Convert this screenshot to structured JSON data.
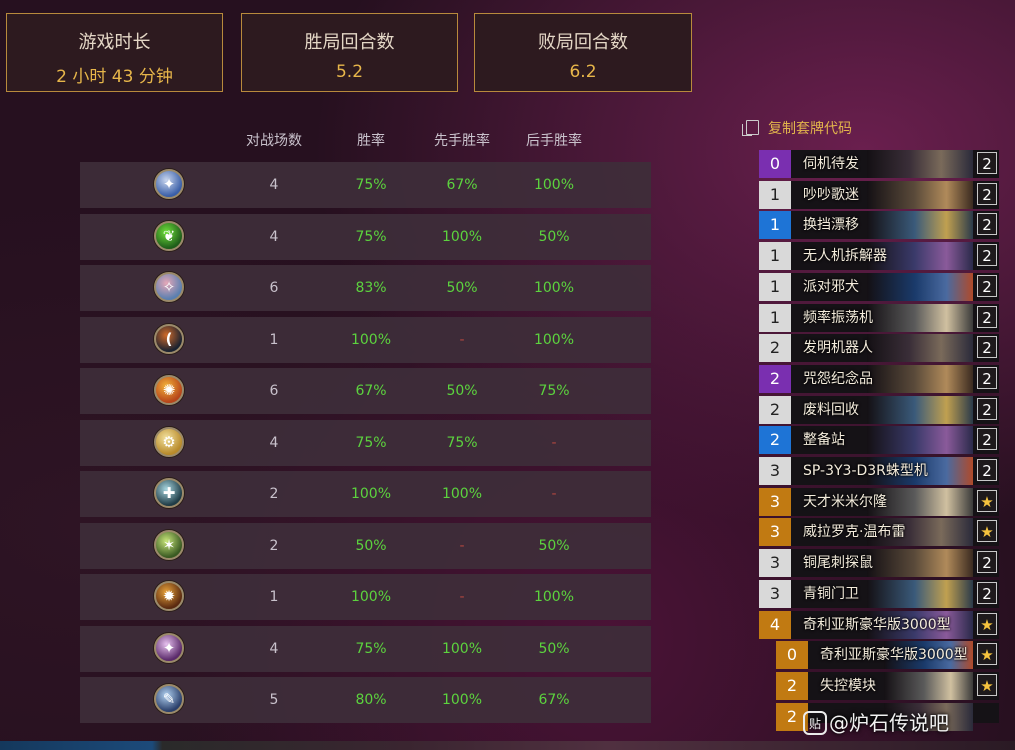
{
  "summary": {
    "cards": [
      {
        "title": "游戏时长",
        "value": "2 小时 43 分钟"
      },
      {
        "title": "胜局回合数",
        "value": "5.2"
      },
      {
        "title": "败局回合数",
        "value": "6.2"
      }
    ]
  },
  "stats_table": {
    "headers": [
      "对战场数",
      "胜率",
      "先手胜率",
      "后手胜率"
    ],
    "rows": [
      {
        "icon": "mage-hero-icon",
        "games": "4",
        "winrate": "75%",
        "first": "67%",
        "second": "100%"
      },
      {
        "icon": "druid-hero-icon",
        "games": "4",
        "winrate": "75%",
        "first": "100%",
        "second": "50%"
      },
      {
        "icon": "shaman-hero-icon",
        "games": "6",
        "winrate": "83%",
        "first": "50%",
        "second": "100%"
      },
      {
        "icon": "hunter-hero-icon",
        "games": "1",
        "winrate": "100%",
        "first": "-",
        "second": "100%"
      },
      {
        "icon": "warlock-hero-icon",
        "games": "6",
        "winrate": "67%",
        "first": "50%",
        "second": "75%"
      },
      {
        "icon": "paladin-hero-icon",
        "games": "4",
        "winrate": "75%",
        "first": "75%",
        "second": "-"
      },
      {
        "icon": "warrior-hero-icon",
        "games": "2",
        "winrate": "100%",
        "first": "100%",
        "second": "-"
      },
      {
        "icon": "rogue-hero-icon",
        "games": "2",
        "winrate": "50%",
        "first": "-",
        "second": "50%"
      },
      {
        "icon": "demon-hunter-hero-icon",
        "games": "1",
        "winrate": "100%",
        "first": "-",
        "second": "100%"
      },
      {
        "icon": "priest-hero-icon",
        "games": "4",
        "winrate": "75%",
        "first": "100%",
        "second": "50%"
      },
      {
        "icon": "death-knight-hero-icon",
        "games": "5",
        "winrate": "80%",
        "first": "100%",
        "second": "67%"
      }
    ]
  },
  "deck": {
    "copy_label": "复制套牌代码",
    "cards": [
      {
        "cost": "0",
        "name": "伺机待发",
        "count": "2",
        "rarity": "epic"
      },
      {
        "cost": "1",
        "name": "吵吵歌迷",
        "count": "2",
        "rarity": "common"
      },
      {
        "cost": "1",
        "name": "换挡漂移",
        "count": "2",
        "rarity": "rare"
      },
      {
        "cost": "1",
        "name": "无人机拆解器",
        "count": "2",
        "rarity": "common"
      },
      {
        "cost": "1",
        "name": "派对邪犬",
        "count": "2",
        "rarity": "common"
      },
      {
        "cost": "1",
        "name": "频率振荡机",
        "count": "2",
        "rarity": "common"
      },
      {
        "cost": "2",
        "name": "发明机器人",
        "count": "2",
        "rarity": "common"
      },
      {
        "cost": "2",
        "name": "咒怨纪念品",
        "count": "2",
        "rarity": "epic"
      },
      {
        "cost": "2",
        "name": "废料回收",
        "count": "2",
        "rarity": "common"
      },
      {
        "cost": "2",
        "name": "整备站",
        "count": "2",
        "rarity": "rare"
      },
      {
        "cost": "3",
        "name": "SP-3Y3-D3R蛛型机",
        "count": "2",
        "rarity": "common"
      },
      {
        "cost": "3",
        "name": "天才米米尔隆",
        "count": "★",
        "rarity": "legendary"
      },
      {
        "cost": "3",
        "name": "威拉罗克·温布雷",
        "count": "★",
        "rarity": "legendary"
      },
      {
        "cost": "3",
        "name": "铜尾刺探鼠",
        "count": "2",
        "rarity": "common"
      },
      {
        "cost": "3",
        "name": "青铜门卫",
        "count": "2",
        "rarity": "common"
      },
      {
        "cost": "4",
        "name": "奇利亚斯豪华版3000型",
        "count": "★",
        "rarity": "legendary"
      },
      {
        "cost": "0",
        "name": "奇利亚斯豪华版3000型",
        "count": "★",
        "rarity": "legendary",
        "sub": true
      },
      {
        "cost": "2",
        "name": "失控模块",
        "count": "★",
        "rarity": "legendary",
        "sub": true
      },
      {
        "cost": "2",
        "name": "",
        "count": "",
        "rarity": "legendary",
        "sub": true
      }
    ]
  },
  "watermark": {
    "icon": "tieba-icon",
    "text": "@炉石传说吧"
  },
  "colors": {
    "accent_gold": "#e7b64a",
    "win_green": "#5cd33e",
    "dash_red": "#b0473f",
    "common": "#d9d9d9",
    "rare": "#1e74d6",
    "epic": "#7a2fb0",
    "legendary": "#c17a12"
  }
}
